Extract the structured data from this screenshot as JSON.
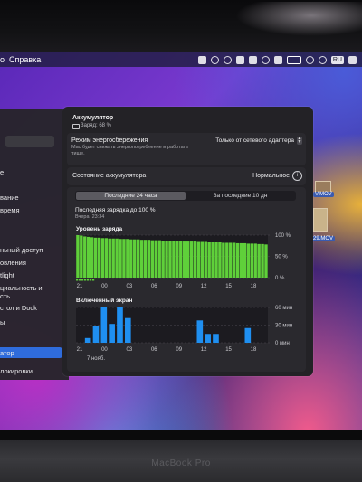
{
  "menubar": {
    "left_fragment": "о",
    "help_menu": "Справка",
    "keyboard_layout": "RU"
  },
  "sidebar": {
    "items": [
      {
        "label": "е"
      },
      {
        "label": "вание"
      },
      {
        "label": "время"
      },
      {
        "label": "ньный доступ"
      },
      {
        "label": "овления"
      },
      {
        "label": "tlight"
      },
      {
        "label": "циальность и"
      },
      {
        "label": "сть"
      },
      {
        "label": "стол и Dock"
      },
      {
        "label": "ы"
      },
      {
        "label": "атор"
      },
      {
        "label": "локировки"
      }
    ],
    "active_index": 10
  },
  "battery": {
    "title": "Аккумулятор",
    "charge_text": "Заряд: 68 %",
    "low_power_mode_title": "Режим энергосбережения",
    "low_power_mode_desc": "Mac будет снижать энергопотребление и работать тише.",
    "low_power_mode_value": "Только от сетевого адаптера",
    "health_label": "Состояние аккумулятора",
    "health_value": "Нормальное",
    "tabs": [
      "Последние 24 часа",
      "За последние 10 дн"
    ],
    "active_tab": 0,
    "last_charge_label": "Последняя зарядка до 100 %",
    "last_charge_time": "Вчера, 23:34"
  },
  "desktop": {
    "file_1": "V.MOV",
    "file_2": "29.MOV"
  },
  "hardware_label": "MacBook Pro",
  "colors": {
    "battery_green": "#5fd03a",
    "screen_blue": "#1f8ff0",
    "tab_active": "#5b5a60",
    "sidebar_active": "#2f6cdc"
  },
  "chart_data": [
    {
      "type": "area",
      "title": "Уровень заряда",
      "x_ticks": [
        "21",
        "00",
        "03",
        "06",
        "09",
        "12",
        "15",
        "18"
      ],
      "y_ticks": [
        "100 %",
        "50 %",
        "0 %"
      ],
      "ylim": [
        0,
        100
      ],
      "unit": "%",
      "values": [
        100,
        99,
        97,
        96,
        95,
        94,
        94,
        93,
        93,
        92,
        92,
        92,
        91,
        91,
        91,
        90,
        90,
        90,
        89,
        89,
        89,
        88,
        88,
        88,
        87,
        87,
        87,
        86,
        86,
        86,
        85,
        85,
        85,
        85,
        84,
        84,
        84,
        83,
        83,
        83,
        83,
        82,
        82,
        82,
        82,
        81,
        81,
        81,
        80,
        80,
        80,
        79,
        79,
        78
      ],
      "charging_markers": [
        "21",
        "00"
      ]
    },
    {
      "type": "bar",
      "title": "Включенный экран",
      "x_ticks": [
        "21",
        "00",
        "03",
        "06",
        "09",
        "12",
        "15",
        "18"
      ],
      "date_label": "7 нояб.",
      "y_ticks": [
        "60 мин",
        "30 мин",
        "0 мин"
      ],
      "ylim": [
        0,
        60
      ],
      "unit": "мин",
      "hours": [
        "22",
        "23",
        "00",
        "01",
        "02",
        "03",
        "12",
        "13",
        "14",
        "18"
      ],
      "values": [
        8,
        28,
        60,
        32,
        60,
        42,
        38,
        15,
        15,
        25
      ]
    }
  ]
}
